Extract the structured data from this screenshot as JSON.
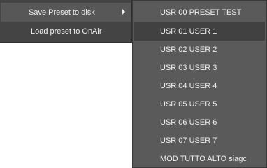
{
  "main_menu": {
    "items": [
      {
        "label": "Save Preset to disk",
        "has_submenu": true,
        "active": true
      },
      {
        "label": "Load preset to OnAir",
        "has_submenu": false,
        "active": false
      }
    ],
    "submenu_arrow_icon": "chevron-right-icon"
  },
  "submenu": {
    "items": [
      {
        "label": "USR 00 PRESET TEST"
      },
      {
        "label": "USR 01 USER 1",
        "active": true
      },
      {
        "label": "USR 02 USER 2"
      },
      {
        "label": "USR 03 USER 3"
      },
      {
        "label": "USR 04 USER 4"
      },
      {
        "label": "USR 05 USER 5"
      },
      {
        "label": "USR 06 USER 6"
      },
      {
        "label": "USR 07 USER 7"
      },
      {
        "label": "MOD TUTTO ALTO siagc"
      }
    ]
  },
  "colors": {
    "menu_bg": "#444444",
    "menu_active": "#575757",
    "submenu_bg": "#5a5a5a",
    "submenu_active": "#414141",
    "text": "#f0f0f0"
  }
}
